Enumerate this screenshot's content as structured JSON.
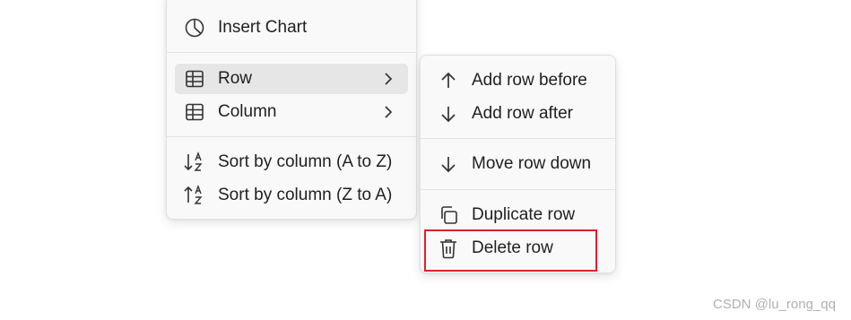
{
  "main_menu": {
    "items": [
      {
        "label": "Insert Chart",
        "icon": "pie-chart-icon"
      },
      {
        "label": "Row",
        "icon": "table-icon",
        "submenu": true,
        "hovered": true
      },
      {
        "label": "Column",
        "icon": "table-icon",
        "submenu": true
      },
      {
        "label": "Sort by column (A to Z)",
        "icon": "sort-ascending-icon"
      },
      {
        "label": "Sort by column (Z to A)",
        "icon": "sort-descending-icon"
      }
    ]
  },
  "row_submenu": {
    "items": [
      {
        "label": "Add row before",
        "icon": "arrow-up-icon"
      },
      {
        "label": "Add row after",
        "icon": "arrow-down-icon"
      },
      {
        "label": "Move row down",
        "icon": "arrow-down-icon"
      },
      {
        "label": "Duplicate row",
        "icon": "copy-icon"
      },
      {
        "label": "Delete row",
        "icon": "trash-icon",
        "highlighted": true
      }
    ]
  },
  "highlight_color": "#e0202a",
  "watermark": "CSDN @lu_rong_qq"
}
